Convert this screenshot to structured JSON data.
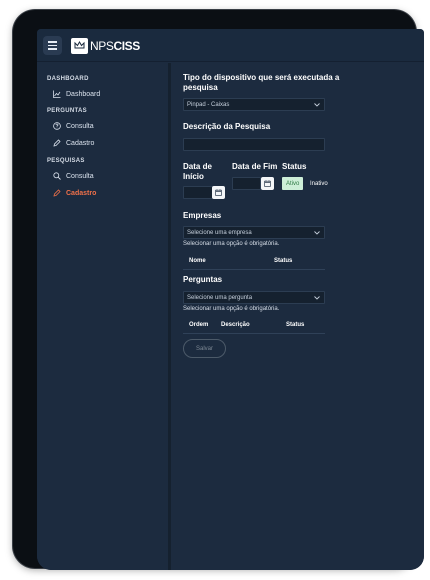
{
  "app": {
    "logo_prefix": "NPS",
    "logo_suffix": "CISS"
  },
  "sidebar": {
    "sections": [
      {
        "label": "DASHBOARD"
      },
      {
        "label": "PERGUNTAS"
      },
      {
        "label": "PESQUISAS"
      }
    ],
    "items": [
      {
        "label": "Dashboard",
        "icon": "chart-line-icon"
      },
      {
        "label": "Consulta",
        "icon": "help-circle-icon"
      },
      {
        "label": "Cadastro",
        "icon": "pencil-icon"
      },
      {
        "label": "Consulta",
        "icon": "search-icon"
      },
      {
        "label": "Cadastro",
        "icon": "pencil-icon",
        "active": true
      }
    ]
  },
  "form": {
    "device_type_label": "Tipo do dispositivo que será executada a pesquisa",
    "device_type_value": "Pinpad - Caixas",
    "description_label": "Descrição da Pesquisa",
    "description_value": "",
    "start_date_label": "Data de Início",
    "end_date_label": "Data de Fim",
    "status_label": "Status",
    "status_active": "Ativo",
    "status_inactive": "Inativo",
    "companies_label": "Empresas",
    "companies_placeholder": "Selecione uma empresa",
    "companies_hint": "Selecionar uma opção é obrigatória.",
    "companies_columns": [
      "Nome",
      "Status"
    ],
    "questions_label": "Perguntas",
    "questions_placeholder": "Selecione uma pergunta",
    "questions_hint": "Selecionar uma opção é obrigatória.",
    "questions_columns": [
      "Ordem",
      "Descrição",
      "Status"
    ],
    "save_label": "Salvar"
  },
  "colors": {
    "accent_active": "#f0714a",
    "status_active_bg": "#cdeed7",
    "background": "#1c2b3f"
  }
}
